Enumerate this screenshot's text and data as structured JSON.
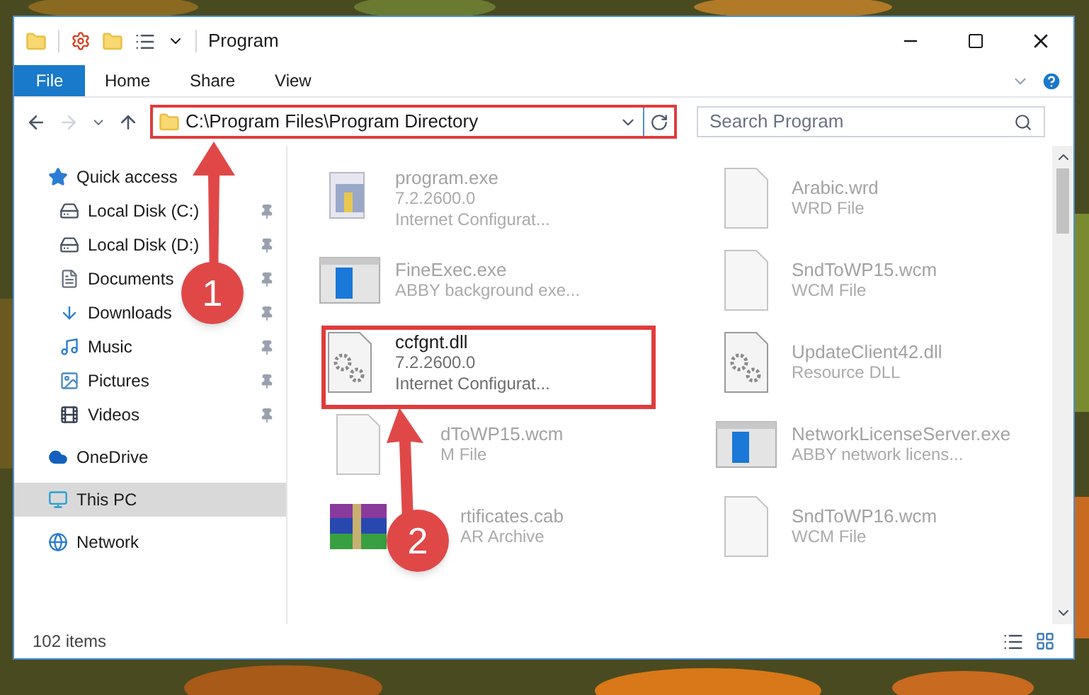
{
  "window": {
    "title": "Program"
  },
  "ribbon": {
    "tabs": [
      {
        "label": "File",
        "kind": "file"
      },
      {
        "label": "Home",
        "kind": "tab"
      },
      {
        "label": "Share",
        "kind": "tab"
      },
      {
        "label": "View",
        "kind": "tab"
      }
    ]
  },
  "address_bar": {
    "path": "C:\\Program Files\\Program Directory"
  },
  "search": {
    "placeholder": "Search Program"
  },
  "navigation": {
    "items": [
      {
        "label": "Quick access",
        "kind": "star",
        "selected": false,
        "children": [
          {
            "label": "Local Disk (C:)",
            "kind": "disk",
            "pinned": true
          },
          {
            "label": "Local Disk (D:)",
            "kind": "disk",
            "pinned": true
          },
          {
            "label": "Documents",
            "kind": "documents",
            "pinned": true
          },
          {
            "label": "Downloads",
            "kind": "downloads",
            "pinned": true
          },
          {
            "label": "Music",
            "kind": "music",
            "pinned": true
          },
          {
            "label": "Pictures",
            "kind": "pictures",
            "pinned": true
          },
          {
            "label": "Videos",
            "kind": "videos",
            "pinned": true
          }
        ]
      },
      {
        "label": "OneDrive",
        "kind": "cloud",
        "selected": false
      },
      {
        "label": "This PC",
        "kind": "pc",
        "selected": true
      },
      {
        "label": "Network",
        "kind": "network",
        "selected": false
      }
    ]
  },
  "files": [
    {
      "name": "program.exe",
      "details": [
        "7.2.2600.0",
        "Internet Configurat..."
      ],
      "kind": "app",
      "dimmed": true
    },
    {
      "name": "Arabic.wrd",
      "details": [
        "WRD File"
      ],
      "kind": "blank",
      "dimmed": true
    },
    {
      "name": "FineExec.exe",
      "details": [
        "ABBY background exe..."
      ],
      "kind": "window",
      "dimmed": true
    },
    {
      "name": "SndToWP15.wcm",
      "details": [
        "WCM File"
      ],
      "kind": "blank",
      "dimmed": true
    },
    {
      "name": "ccfgnt.dll",
      "details": [
        "7.2.2600.0",
        "Internet Configurat..."
      ],
      "kind": "dll",
      "dimmed": false
    },
    {
      "name": "UpdateClient42.dll",
      "details": [
        "Resource DLL"
      ],
      "kind": "dll",
      "dimmed": true
    },
    {
      "name": "dToWP15.wcm",
      "details": [
        "M File"
      ],
      "kind": "blank",
      "dimmed": true
    },
    {
      "name": "NetworkLicenseServer.exe",
      "details": [
        "ABBY network licens..."
      ],
      "kind": "window",
      "dimmed": true
    },
    {
      "name": "rtificates.cab",
      "details": [
        "AR Archive"
      ],
      "kind": "archive",
      "dimmed": true
    },
    {
      "name": "SndToWP16.wcm",
      "details": [
        "WCM File"
      ],
      "kind": "blank",
      "dimmed": true
    }
  ],
  "status_bar": {
    "count": "102 items"
  },
  "annotations": [
    {
      "label": "1"
    },
    {
      "label": "2"
    }
  ]
}
